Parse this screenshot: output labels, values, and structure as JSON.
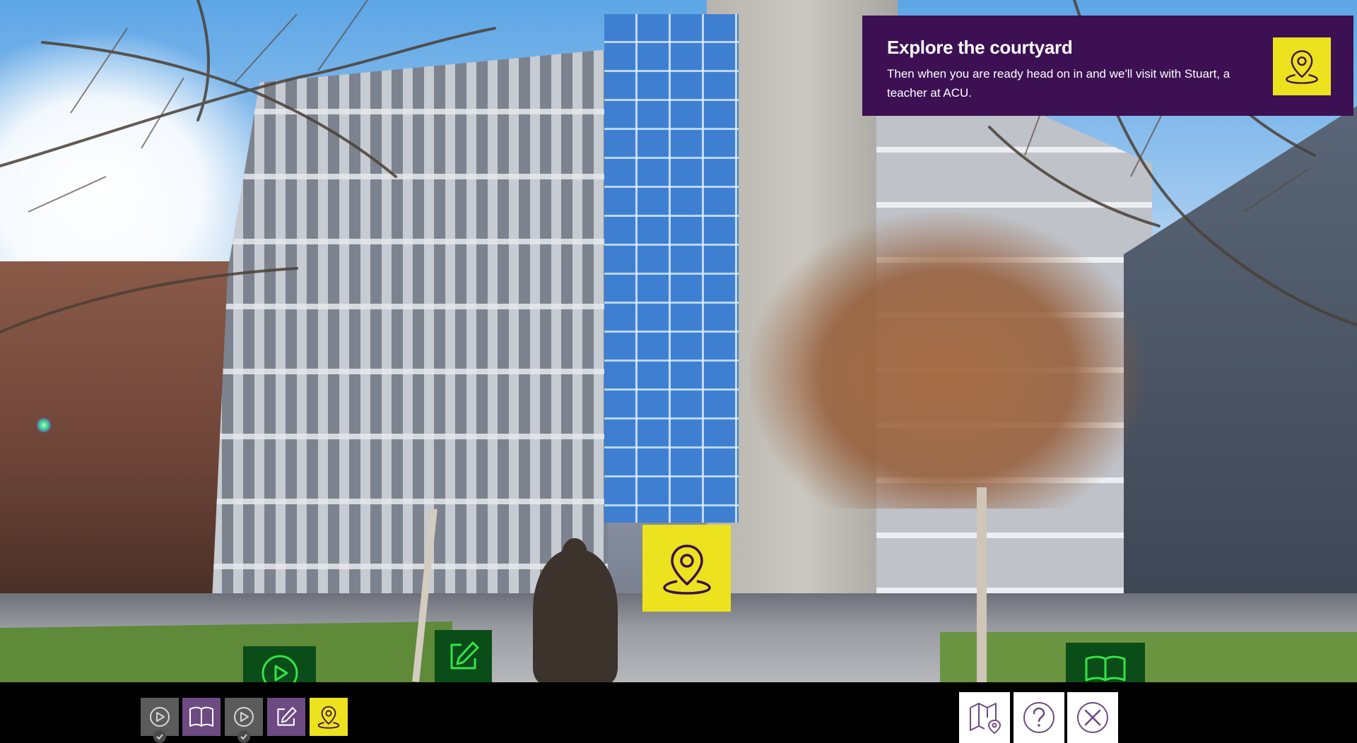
{
  "banner": {
    "title": "Explore the courtyard",
    "text": "Then when you are ready head on in and we'll visit with Stuart, a teacher at ACU.",
    "icon": "map-pin-icon"
  },
  "scene": {
    "hotspots": [
      {
        "name": "location-hotspot",
        "icon": "map-pin-icon",
        "color": "#ece21d"
      },
      {
        "name": "video-hotspot",
        "icon": "play-icon",
        "color": "#0a4d18"
      },
      {
        "name": "activity-hotspot",
        "icon": "edit-icon",
        "color": "#0a4d18"
      },
      {
        "name": "reading-hotspot",
        "icon": "book-icon",
        "color": "#0a4d18"
      }
    ]
  },
  "progress": {
    "steps": [
      {
        "icon": "play-icon",
        "color": "#5b5b5b",
        "completed": true
      },
      {
        "icon": "book-icon",
        "color": "#6e4a83",
        "completed": false
      },
      {
        "icon": "play-icon",
        "color": "#5b5b5b",
        "completed": true
      },
      {
        "icon": "edit-icon",
        "color": "#6e4a83",
        "completed": false
      },
      {
        "icon": "map-pin-icon",
        "color": "#ece21d",
        "completed": false,
        "current": true
      }
    ]
  },
  "controls": [
    {
      "name": "map-button",
      "icon": "map-icon"
    },
    {
      "name": "help-button",
      "icon": "help-icon"
    },
    {
      "name": "close-button",
      "icon": "close-icon"
    }
  ],
  "colors": {
    "brand_purple": "#3c1053",
    "accent_yellow": "#ece21d",
    "hotspot_green": "#0a4d18",
    "icon_purple": "#6e4a83"
  }
}
